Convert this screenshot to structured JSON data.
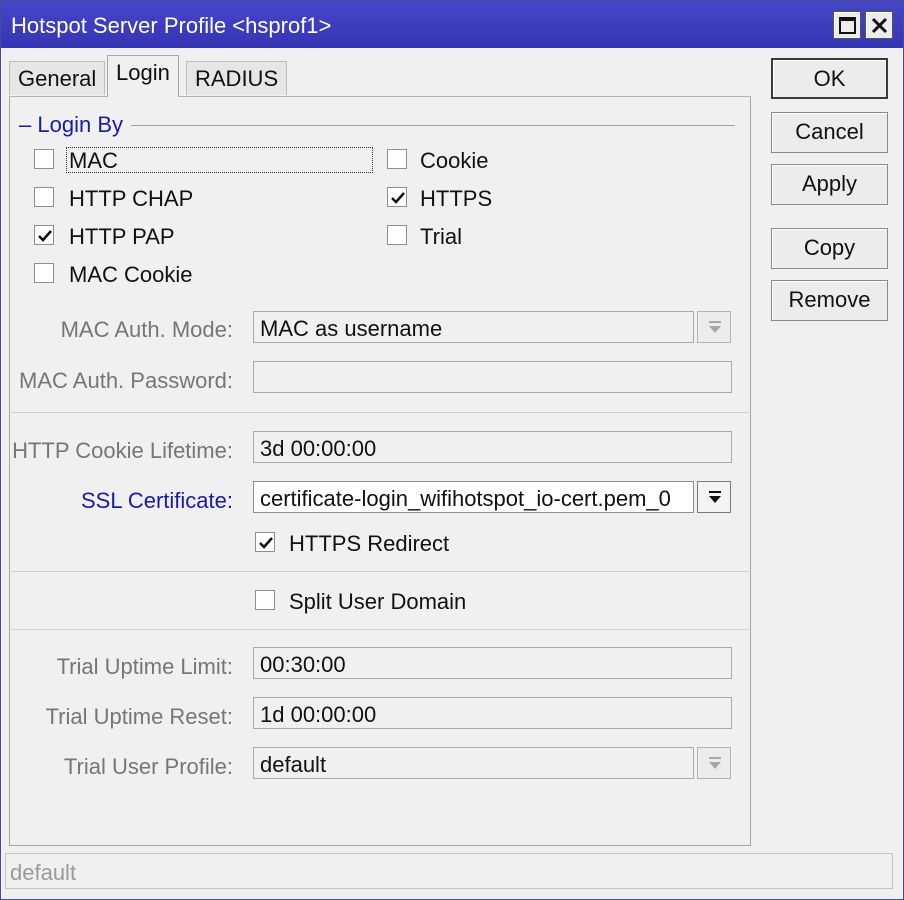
{
  "window": {
    "title": "Hotspot Server Profile <hsprof1>"
  },
  "tabs": [
    {
      "label": "General"
    },
    {
      "label": "Login",
      "active": true
    },
    {
      "label": "RADIUS"
    }
  ],
  "login_by": {
    "legend": "Login By",
    "collapse_glyph": "–",
    "options": [
      {
        "label": "MAC",
        "checked": false
      },
      {
        "label": "HTTP CHAP",
        "checked": false
      },
      {
        "label": "HTTP PAP",
        "checked": true
      },
      {
        "label": "MAC Cookie",
        "checked": false
      },
      {
        "label": "Cookie",
        "checked": false
      },
      {
        "label": "HTTPS",
        "checked": true
      },
      {
        "label": "Trial",
        "checked": false
      }
    ]
  },
  "mac_auth_mode": {
    "label": "MAC Auth. Mode:",
    "value": "MAC as username"
  },
  "mac_auth_password": {
    "label": "MAC Auth. Password:",
    "value": ""
  },
  "http_cookie_lifetime": {
    "label": "HTTP Cookie Lifetime:",
    "value": "3d 00:00:00"
  },
  "ssl_certificate": {
    "label": "SSL Certificate:",
    "value": "certificate-login_wifihotspot_io-cert.pem_0"
  },
  "https_redirect": {
    "label": "HTTPS Redirect",
    "checked": true
  },
  "split_user_domain": {
    "label": "Split User Domain",
    "checked": false
  },
  "trial_uptime_limit": {
    "label": "Trial Uptime Limit:",
    "value": "00:30:00"
  },
  "trial_uptime_reset": {
    "label": "Trial Uptime Reset:",
    "value": "1d 00:00:00"
  },
  "trial_user_profile": {
    "label": "Trial User Profile:",
    "value": "default"
  },
  "buttons": {
    "ok": "OK",
    "cancel": "Cancel",
    "apply": "Apply",
    "copy": "Copy",
    "remove": "Remove"
  },
  "status": {
    "text": "default"
  },
  "colors": {
    "titlebar": "#3b3bbf",
    "label_gray": "#767676",
    "link_blue": "#1a1aa8"
  },
  "icons": {
    "maximize": "maximize-icon",
    "close": "close-icon",
    "checkmark": "checkmark-icon",
    "dropdown": "dropdown-arrow-icon"
  }
}
